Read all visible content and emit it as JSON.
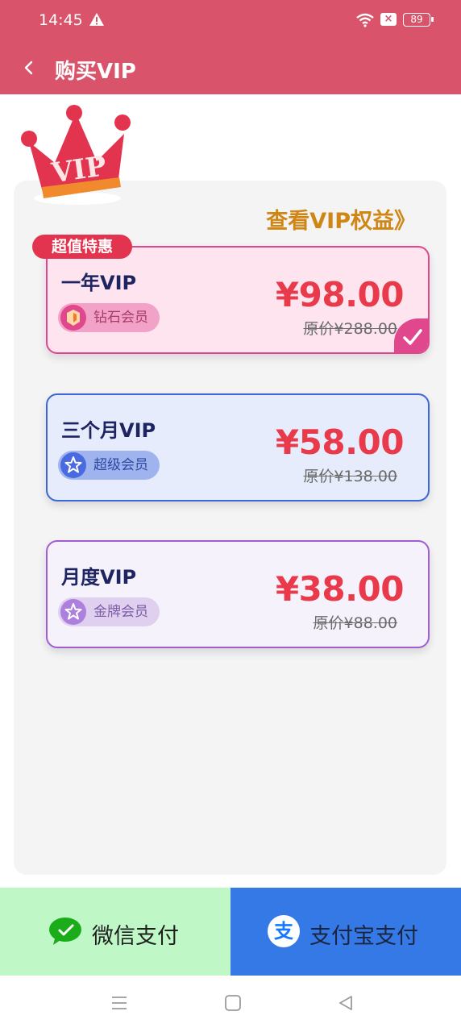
{
  "status_bar": {
    "time": "14:45",
    "battery": "89"
  },
  "header": {
    "title": "购买VIP"
  },
  "crown": {
    "text": "VIP"
  },
  "benefits_link": "查看VIP权益》",
  "ribbon": "超值特惠",
  "plans": [
    {
      "name": "一年VIP",
      "badge": "钻石会员",
      "price": "¥98.00",
      "original": "原价¥288.00",
      "selected": true
    },
    {
      "name": "三个月VIP",
      "badge": "超级会员",
      "price": "¥58.00",
      "original": "原价¥138.00",
      "selected": false
    },
    {
      "name": "月度VIP",
      "badge": "金牌会员",
      "price": "¥38.00",
      "original": "原价¥88.00",
      "selected": false
    }
  ],
  "payment": {
    "wechat": "微信支付",
    "alipay": "支付宝支付"
  },
  "colors": {
    "header": "#d9536a",
    "price": "#e83a4a",
    "benefits": "#d08615",
    "wechat_bg": "#bff8c6",
    "alipay_bg": "#3579e7"
  }
}
